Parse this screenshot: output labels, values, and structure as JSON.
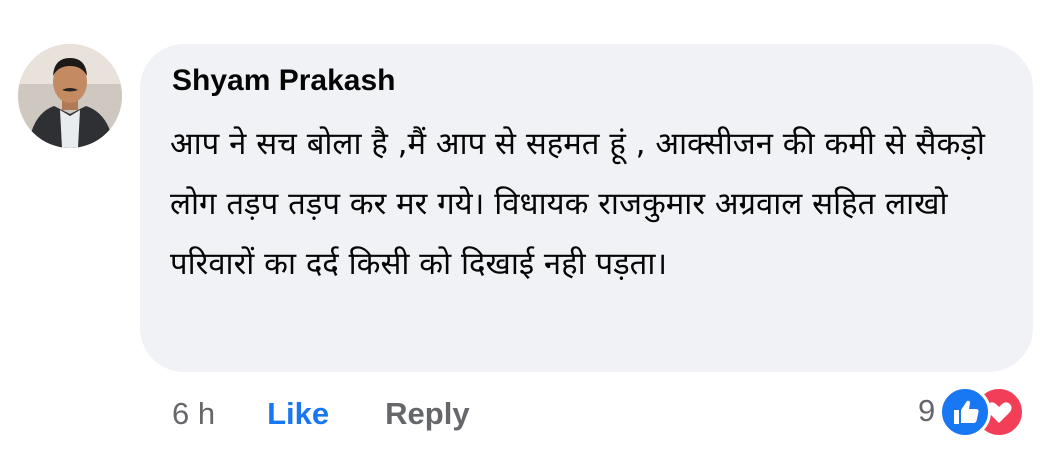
{
  "comment": {
    "author": "Shyam Prakash",
    "text": "आप ने सच बोला है ,मैं आप से सहमत हूं , आक्सीजन की कमी से सैकड़ो लोग तड़प तड़प कर मर गये। विधायक राजकुमार अग्रवाल सहित लाखो परिवारों का दर्द किसी को दिखाई नही पड़ता।",
    "time": "6 h",
    "like_label": "Like",
    "reply_label": "Reply",
    "reaction_count": "9",
    "reaction_icons": [
      "like-icon",
      "love-icon"
    ]
  },
  "colors": {
    "bubble": "#f0f2f5",
    "like_active": "#1877f2",
    "secondary_text": "#65676b",
    "love": "#f33e58"
  }
}
